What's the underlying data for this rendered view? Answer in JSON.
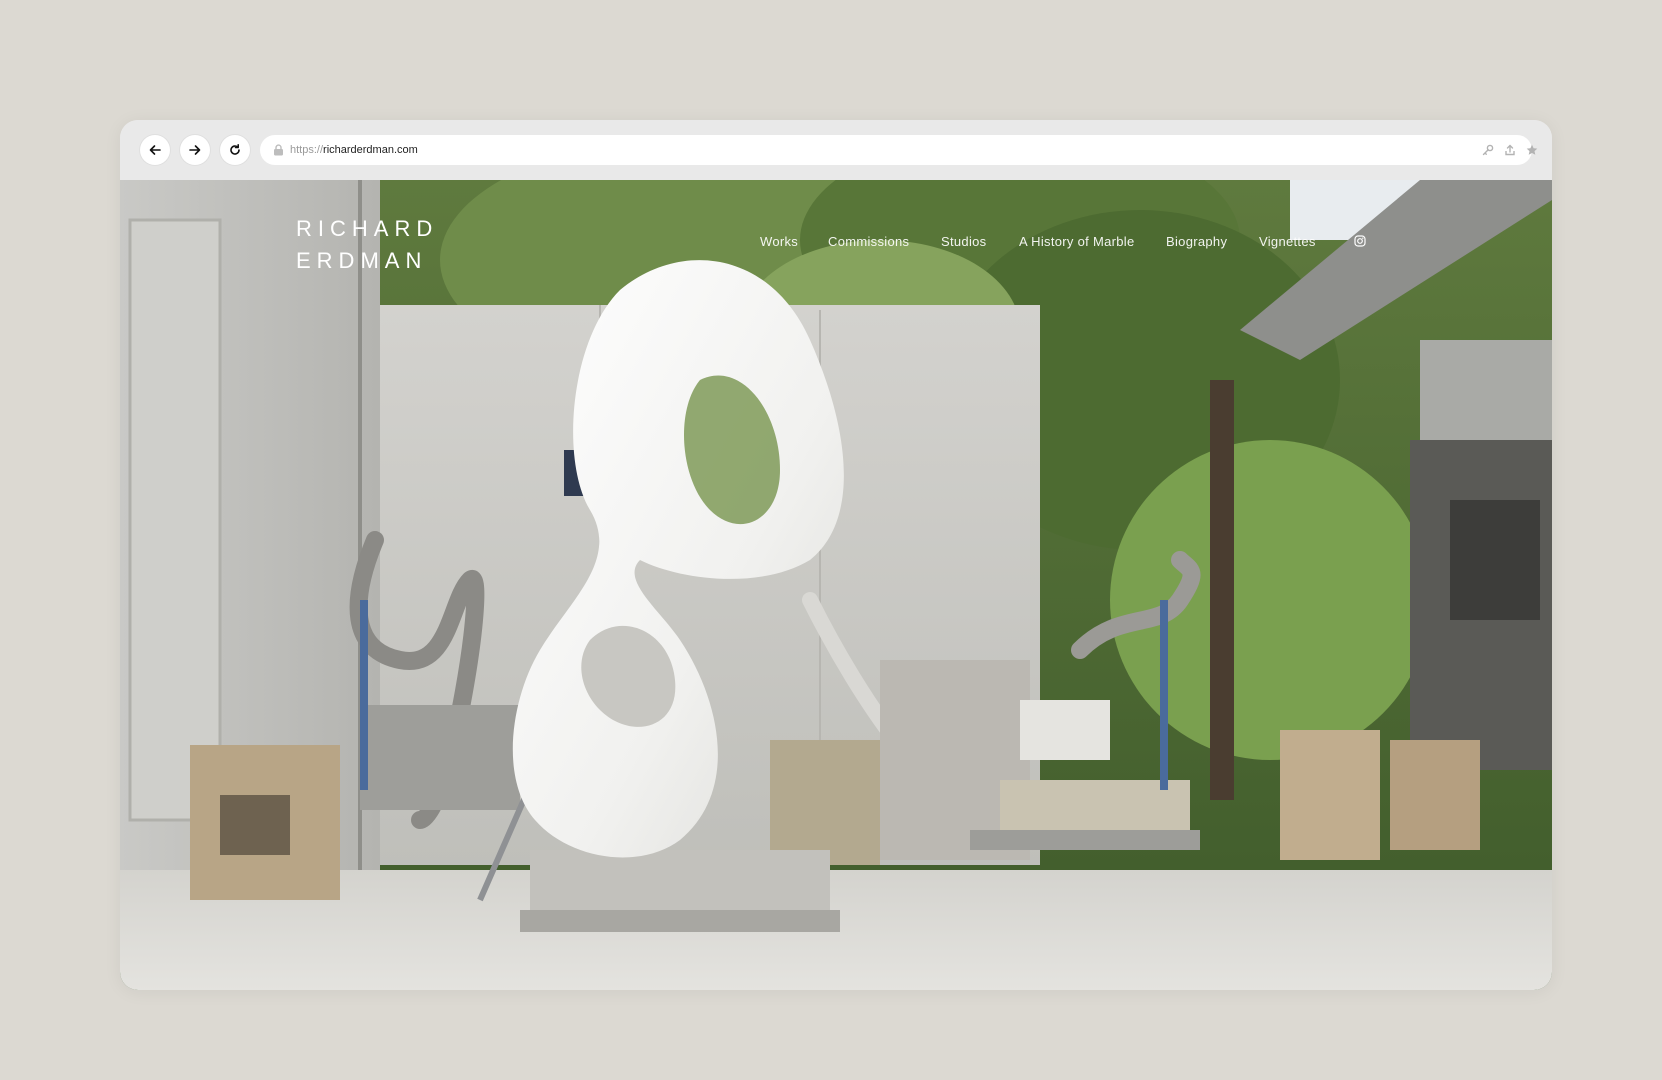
{
  "browser": {
    "url_protocol": "https://",
    "url_host": "richarderdman.com",
    "icons": [
      "back-arrow-icon",
      "forward-arrow-icon",
      "reload-icon",
      "lock-icon",
      "key-icon",
      "share-icon",
      "star-icon"
    ]
  },
  "site": {
    "logo_line1": "RICHARD",
    "logo_line2": "ERDMAN",
    "nav": [
      "Works",
      "Commissions",
      "Studios",
      "A History of Marble",
      "Biography",
      "Vignettes"
    ],
    "social_icon": "instagram-icon"
  },
  "colors": {
    "page_bg": "#dcd9d2",
    "toolbar_bg": "#e9e9e9",
    "nav_text": "#ffffff"
  }
}
